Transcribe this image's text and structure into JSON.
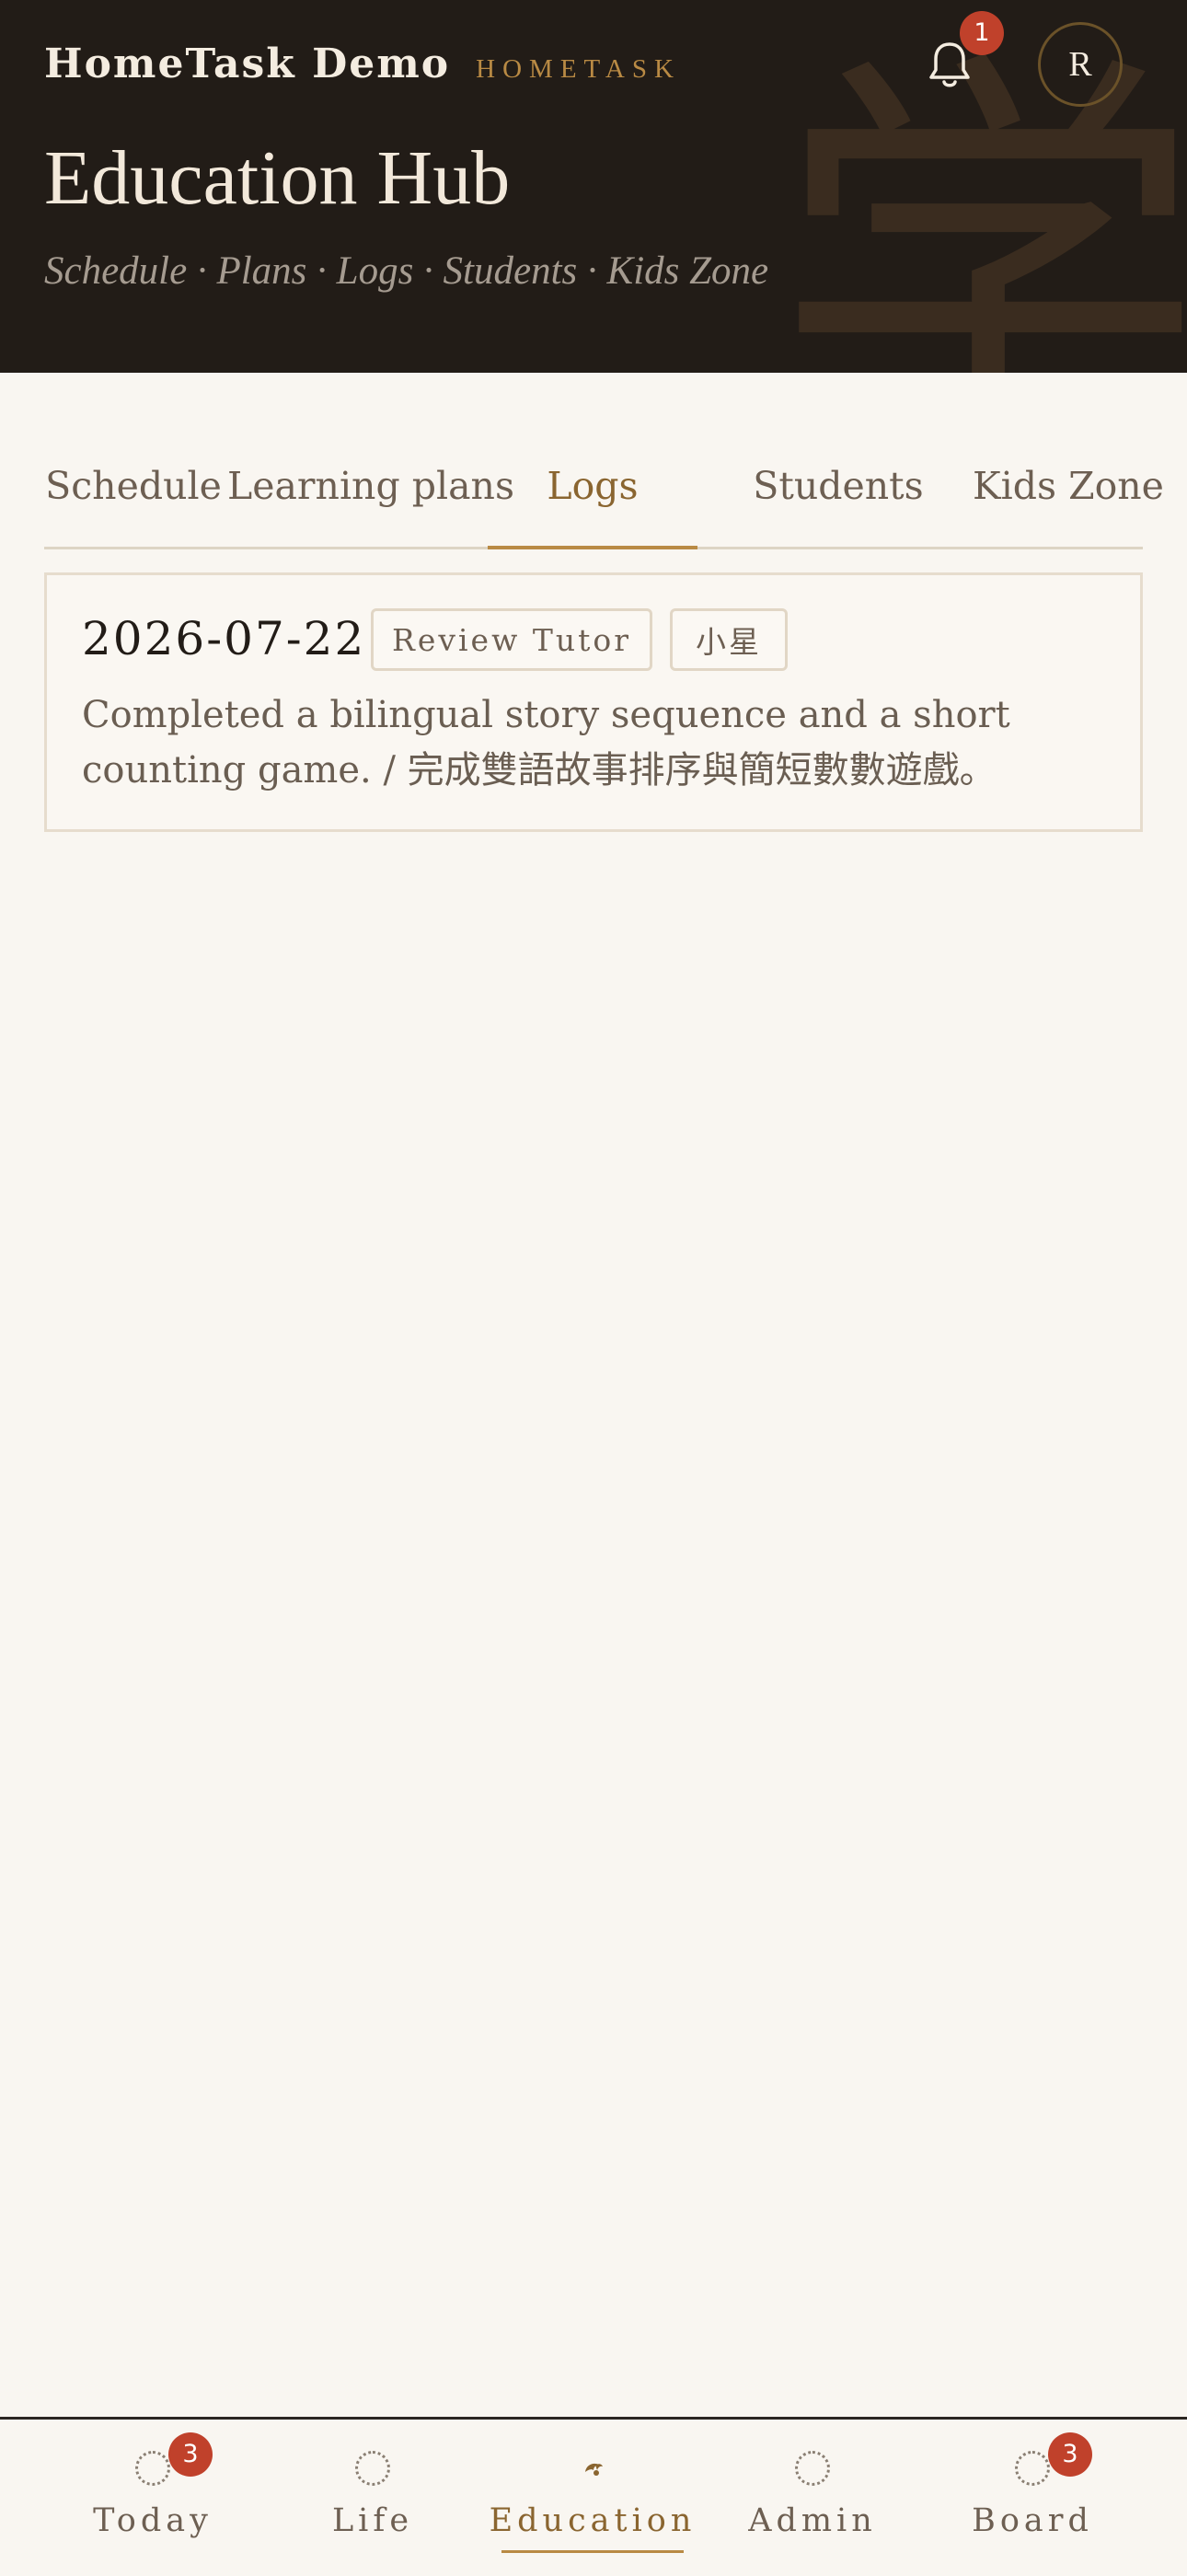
{
  "header": {
    "brand_name": "HomeTask Demo",
    "brand_tag": "HOMETASK",
    "notifications_count": "1",
    "avatar_initial": "R",
    "title": "Education Hub",
    "subtitle": "Schedule · Plans · Logs · Students · Kids Zone",
    "watermark_char": "学"
  },
  "tabs": [
    {
      "label": "Schedule",
      "active": false
    },
    {
      "label": "Learning plans",
      "active": false
    },
    {
      "label": "Logs",
      "active": true
    },
    {
      "label": "Students",
      "active": false
    },
    {
      "label": "Kids Zone",
      "active": false
    }
  ],
  "logs": [
    {
      "date": "2026-07-22",
      "author": "Review Tutor",
      "student": "小星",
      "text": "Completed a bilingual story sequence and a short counting game. / 完成雙語故事排序與簡短數數遊戲。"
    }
  ],
  "bottom_nav": [
    {
      "label": "Today",
      "badge": "3",
      "active": false,
      "icon": "dotted-circle-icon"
    },
    {
      "label": "Life",
      "badge": "",
      "active": false,
      "icon": "dotted-circle-icon"
    },
    {
      "label": "Education",
      "badge": "",
      "active": true,
      "icon": "leaf-icon"
    },
    {
      "label": "Admin",
      "badge": "",
      "active": false,
      "icon": "dotted-circle-icon"
    },
    {
      "label": "Board",
      "badge": "3",
      "active": false,
      "icon": "dotted-circle-icon"
    }
  ],
  "colors": {
    "header_bg": "#221c17",
    "page_bg": "#f9f6f1",
    "accent_gold": "#b98a44",
    "badge_red": "#c0412b",
    "text_muted": "#6d5f52"
  }
}
